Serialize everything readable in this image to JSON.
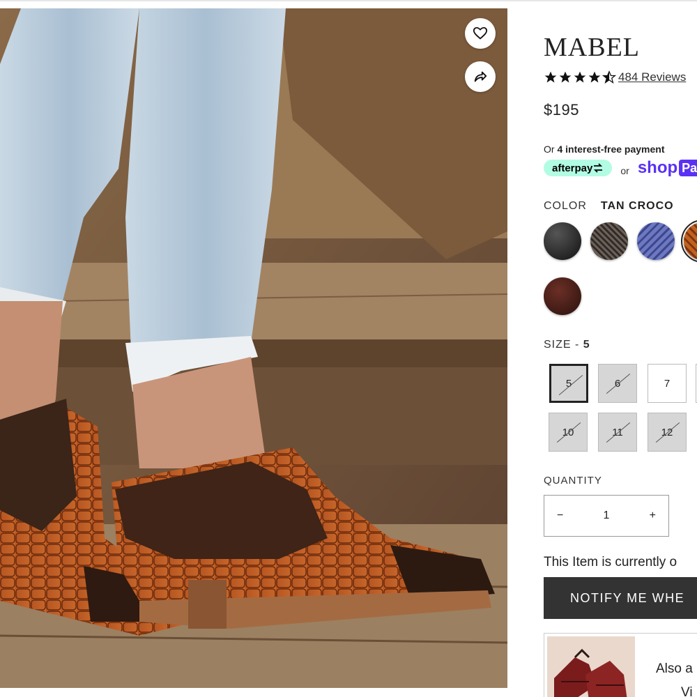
{
  "hero": {
    "favorite_icon": "heart-icon",
    "share_icon": "share-arrow-icon"
  },
  "product": {
    "title": "MABEL",
    "rating": 4.5,
    "reviews_label": "484 Reviews",
    "price": "$195",
    "installments_prefix": "Or ",
    "installments_bold": "4 interest-free payment",
    "afterpay_label": "afterpay",
    "or_label": "or",
    "shop_label": "shop",
    "shop_pay_label": "Pa"
  },
  "color": {
    "label": "COLOR",
    "selected": "TAN CROCO",
    "swatch_colors": [
      "#1c1c1c",
      "#4b4239",
      "#5560a8",
      "#b8561f",
      "#3a1a14"
    ]
  },
  "size": {
    "label": "SIZE - ",
    "selected": "5",
    "options": [
      {
        "label": "5",
        "available": false,
        "selected": true
      },
      {
        "label": "6",
        "available": false,
        "selected": false
      },
      {
        "label": "7",
        "available": true,
        "selected": false
      },
      {
        "label": "10",
        "available": false,
        "selected": false
      },
      {
        "label": "11",
        "available": false,
        "selected": false
      },
      {
        "label": "12",
        "available": false,
        "selected": false
      }
    ]
  },
  "quantity": {
    "label": "QUANTITY",
    "minus": "−",
    "value": "1",
    "plus": "+"
  },
  "availability_text": "This Item is currently o",
  "notify_button": "NOTIFY ME WHE",
  "also_available": {
    "text": "Also a",
    "link": "Vi"
  },
  "colors": {
    "afterpay_mint": "#b2fce4",
    "shop_purple": "#5a31f4",
    "button_dark": "#333333"
  }
}
